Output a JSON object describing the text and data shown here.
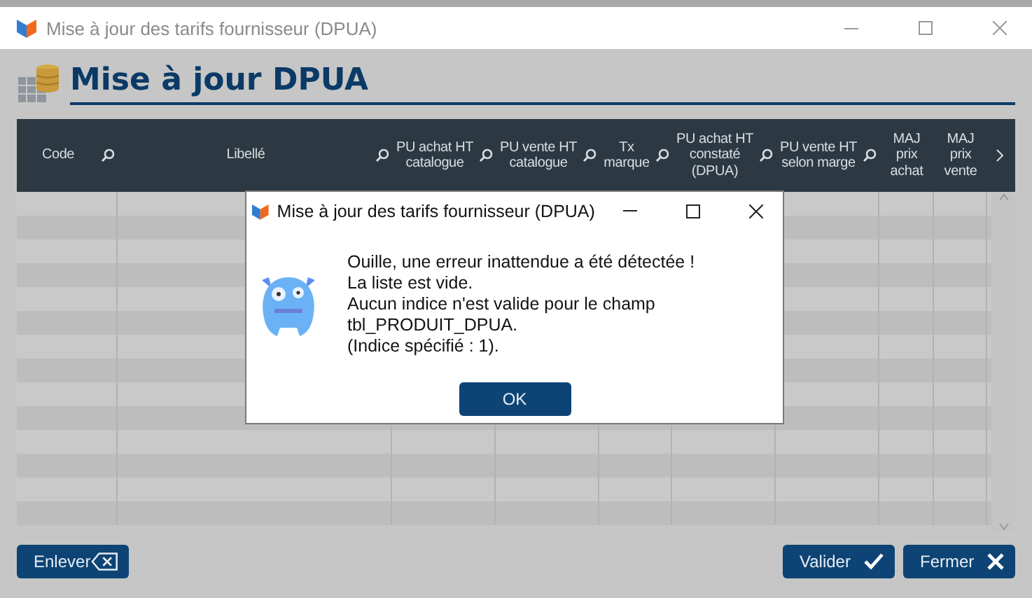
{
  "window": {
    "title": "Mise à jour des tarifs fournisseur (DPUA)"
  },
  "page_title": "Mise à jour DPUA",
  "table": {
    "columns": [
      {
        "label": "Code",
        "searchable": true
      },
      {
        "label": "Libellé",
        "searchable": true
      },
      {
        "label": "PU achat HT catalogue",
        "searchable": true
      },
      {
        "label": "PU vente HT catalogue",
        "searchable": true
      },
      {
        "label": "Tx marque",
        "searchable": true
      },
      {
        "label": "PU achat HT constaté (DPUA)",
        "searchable": true
      },
      {
        "label": "PU vente HT selon marge",
        "searchable": true
      },
      {
        "label": "MAJ prix achat",
        "searchable": false
      },
      {
        "label": "MAJ prix vente",
        "searchable": false
      }
    ]
  },
  "buttons": [
    {
      "label": "Enlever",
      "kind": "remove"
    },
    {
      "label": "Valider",
      "kind": "confirm"
    },
    {
      "label": "Fermer",
      "kind": "close"
    }
  ],
  "dialog": {
    "title": "Mise à jour des tarifs fournisseur (DPUA)",
    "message": [
      "Ouille, une erreur inattendue a été détectée !",
      "La liste est vide.",
      "Aucun indice n'est valide pour le champ",
      "tbl_PRODUIT_DPUA.",
      "(Indice spécifié : 1)."
    ],
    "button": "OK"
  }
}
